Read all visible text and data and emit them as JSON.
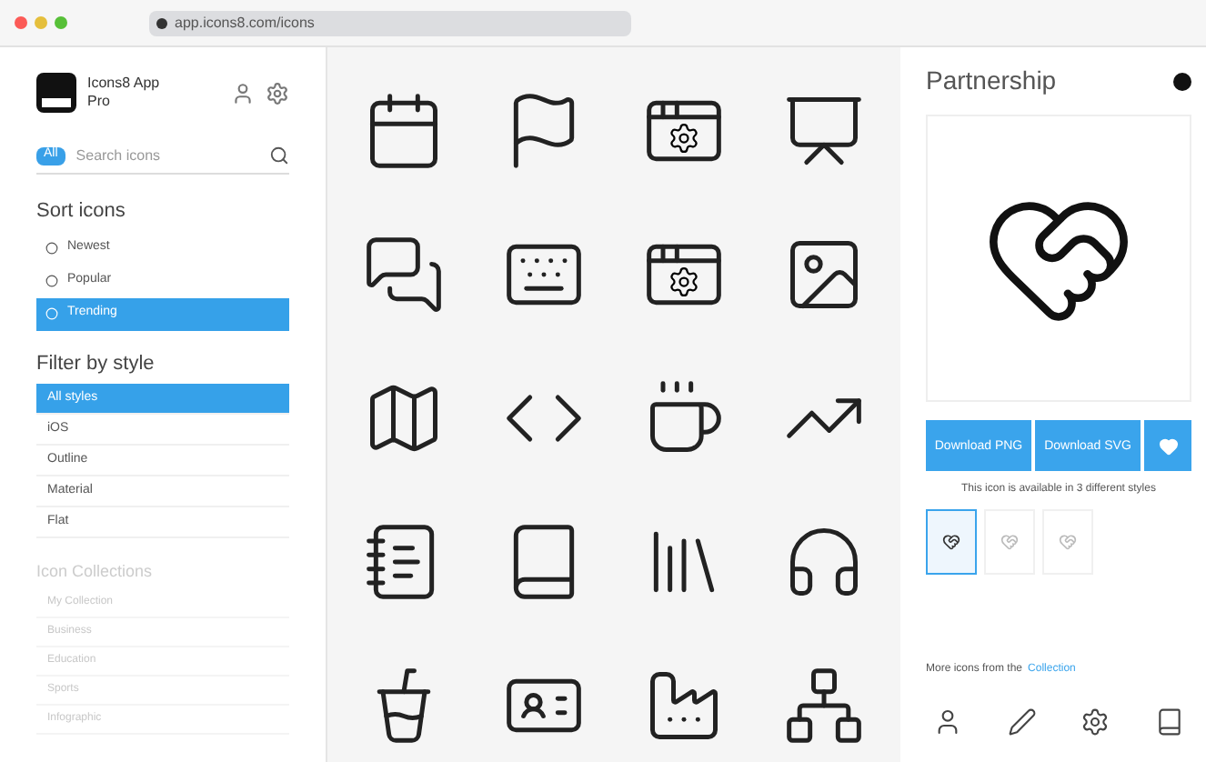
{
  "address_bar": {
    "url": "app.icons8.com/icons"
  },
  "app": {
    "name": "Icons8 App",
    "plan": "Pro"
  },
  "search": {
    "chip": "All",
    "placeholder": "Search icons"
  },
  "sort": {
    "title": "Sort icons",
    "items": [
      {
        "label": "Newest",
        "selected": false
      },
      {
        "label": "Popular",
        "selected": false
      },
      {
        "label": "Trending",
        "selected": true
      }
    ]
  },
  "filter": {
    "title": "Filter by style",
    "items": [
      {
        "label": "All styles",
        "selected": true
      },
      {
        "label": "iOS",
        "selected": false
      },
      {
        "label": "Outline",
        "selected": false
      },
      {
        "label": "Material",
        "selected": false
      },
      {
        "label": "Flat",
        "selected": false
      }
    ]
  },
  "collections": {
    "title": "Icon Collections",
    "items": [
      "My Collection",
      "Business",
      "Education",
      "Sports",
      "Infographic"
    ]
  },
  "icon_grid": [
    {
      "kind": "calendar"
    },
    {
      "kind": "flag"
    },
    {
      "kind": "window-gear"
    },
    {
      "kind": "presenter"
    },
    {
      "kind": "chat"
    },
    {
      "kind": "keyboard"
    },
    {
      "kind": "window-gear"
    },
    {
      "kind": "easel"
    },
    {
      "kind": "map"
    },
    {
      "kind": "code"
    },
    {
      "kind": "mug"
    },
    {
      "kind": "chart"
    },
    {
      "kind": "notebook"
    },
    {
      "kind": "book"
    },
    {
      "kind": "binders"
    },
    {
      "kind": "headset"
    },
    {
      "kind": "cup"
    },
    {
      "kind": "badge"
    },
    {
      "kind": "factory"
    },
    {
      "kind": "hierarchy"
    }
  ],
  "detail": {
    "title": "Partnership",
    "buttons": [
      "Download PNG",
      "Download SVG"
    ],
    "styles_note": "This icon is available in 3 different styles",
    "variants": [
      {
        "selected": true
      },
      {
        "selected": false
      },
      {
        "selected": false
      }
    ],
    "more_text": "More icons from the",
    "more_link": "Collection",
    "more_icons": [
      {
        "kind": "user"
      },
      {
        "kind": "pen"
      },
      {
        "kind": "gear"
      },
      {
        "kind": "book"
      }
    ]
  }
}
